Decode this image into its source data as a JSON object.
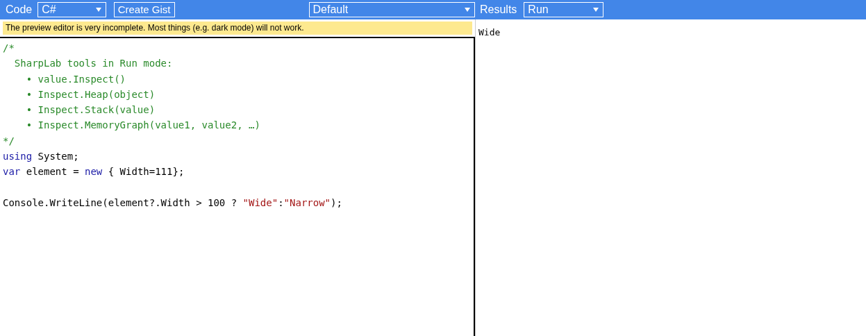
{
  "toolbar": {
    "code_label": "Code",
    "language_select": {
      "value": "C#"
    },
    "create_gist_button": "Create Gist",
    "branch_select": {
      "value": "Default"
    },
    "results_label": "Results",
    "mode_select": {
      "value": "Run"
    }
  },
  "notice": "The preview editor is very incomplete. Most things (e.g. dark mode) will not work.",
  "editor": {
    "lines": [
      {
        "kind": "code",
        "tokens": [
          {
            "kind": "comment",
            "text": "/*"
          }
        ]
      },
      {
        "kind": "code",
        "tokens": [
          {
            "kind": "comment",
            "text": "  SharpLab tools in Run mode:"
          }
        ]
      },
      {
        "kind": "code",
        "tokens": [
          {
            "kind": "comment",
            "text": "    • value.Inspect()"
          }
        ]
      },
      {
        "kind": "code",
        "tokens": [
          {
            "kind": "comment",
            "text": "    • Inspect.Heap(object)"
          }
        ]
      },
      {
        "kind": "code",
        "tokens": [
          {
            "kind": "comment",
            "text": "    • Inspect.Stack(value)"
          }
        ]
      },
      {
        "kind": "code",
        "tokens": [
          {
            "kind": "comment",
            "text": "    • Inspect.MemoryGraph(value1, value2, …)"
          }
        ]
      },
      {
        "kind": "code",
        "tokens": [
          {
            "kind": "comment",
            "text": "*/"
          }
        ]
      },
      {
        "kind": "code",
        "tokens": [
          {
            "kind": "keyword",
            "text": "using"
          },
          {
            "kind": "plain",
            "text": " System;"
          }
        ]
      },
      {
        "kind": "code",
        "tokens": [
          {
            "kind": "keyword",
            "text": "var"
          },
          {
            "kind": "plain",
            "text": " element = "
          },
          {
            "kind": "keyword",
            "text": "new"
          },
          {
            "kind": "plain",
            "text": " { Width=111};"
          }
        ]
      },
      {
        "kind": "blank"
      },
      {
        "kind": "code",
        "tokens": [
          {
            "kind": "plain",
            "text": "Console.WriteLine(element?.Width > 100 ? "
          },
          {
            "kind": "string",
            "text": "\"Wide\""
          },
          {
            "kind": "plain",
            "text": ":"
          },
          {
            "kind": "string",
            "text": "\"Narrow\""
          },
          {
            "kind": "plain",
            "text": ");"
          }
        ]
      }
    ]
  },
  "results": {
    "output": "Wide"
  }
}
